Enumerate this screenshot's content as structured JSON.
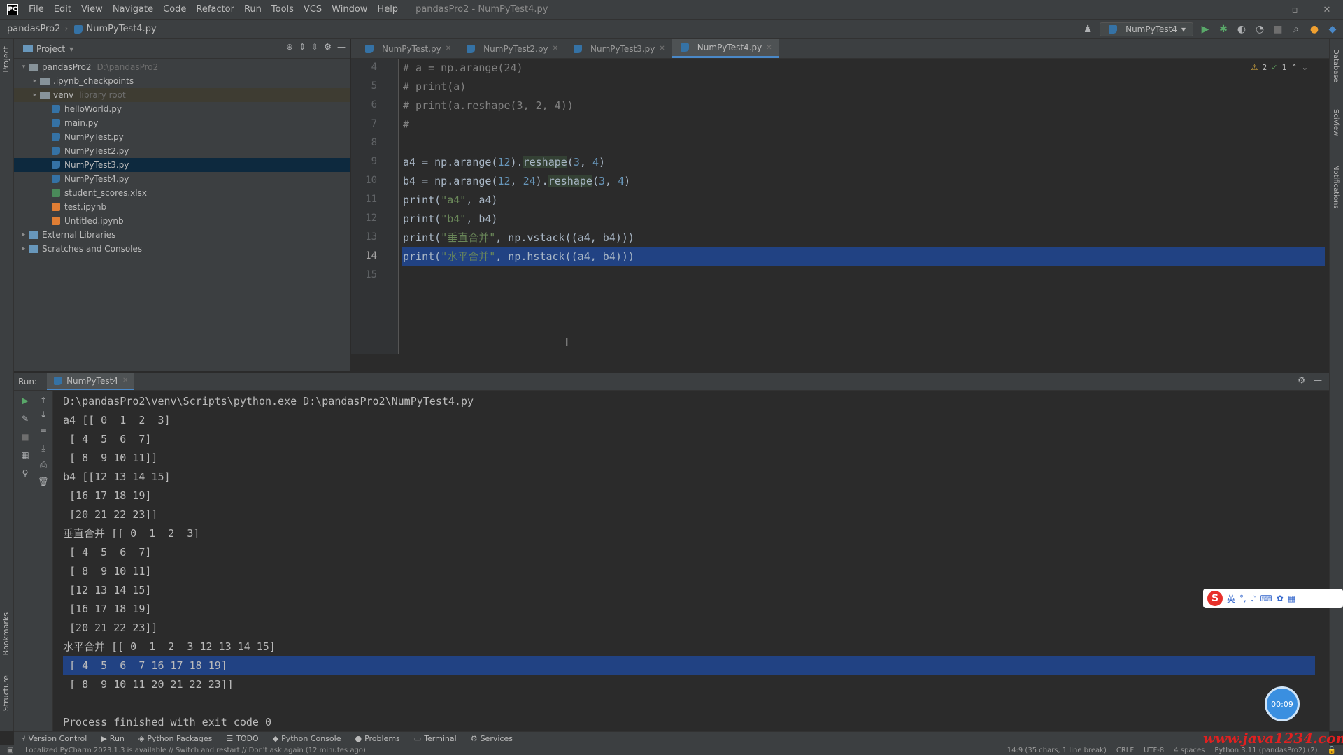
{
  "window": {
    "logo": "PC",
    "menu": [
      "File",
      "Edit",
      "View",
      "Navigate",
      "Code",
      "Refactor",
      "Run",
      "Tools",
      "VCS",
      "Window",
      "Help"
    ],
    "title": "pandasPro2 - NumPyTest4.py",
    "minimize": "–",
    "maximize": "▫",
    "close": "✕"
  },
  "navbar": {
    "project": "pandasPro2",
    "file": "NumPyTest4.py",
    "run_config": "NumPyTest4"
  },
  "project_panel": {
    "title": "Project",
    "items": [
      {
        "label": "pandasPro2",
        "hint": "D:\\pandasPro2",
        "icon": "folder-icon",
        "depth": 0,
        "arrow": "▾"
      },
      {
        "label": ".ipynb_checkpoints",
        "hint": "",
        "icon": "folder-icon",
        "depth": 1,
        "arrow": "▸"
      },
      {
        "label": "venv",
        "hint": "library root",
        "icon": "folder-icon",
        "depth": 1,
        "arrow": "▸"
      },
      {
        "label": "helloWorld.py",
        "hint": "",
        "icon": "python-file-icon",
        "depth": 2,
        "arrow": ""
      },
      {
        "label": "main.py",
        "hint": "",
        "icon": "python-file-icon",
        "depth": 2,
        "arrow": ""
      },
      {
        "label": "NumPyTest.py",
        "hint": "",
        "icon": "python-file-icon",
        "depth": 2,
        "arrow": ""
      },
      {
        "label": "NumPyTest2.py",
        "hint": "",
        "icon": "python-file-icon",
        "depth": 2,
        "arrow": ""
      },
      {
        "label": "NumPyTest3.py",
        "hint": "",
        "icon": "python-file-icon",
        "depth": 2,
        "arrow": ""
      },
      {
        "label": "NumPyTest4.py",
        "hint": "",
        "icon": "python-file-icon",
        "depth": 2,
        "arrow": ""
      },
      {
        "label": "student_scores.xlsx",
        "hint": "",
        "icon": "excel-file-icon",
        "depth": 2,
        "arrow": ""
      },
      {
        "label": "test.ipynb",
        "hint": "",
        "icon": "notebook-file-icon",
        "depth": 2,
        "arrow": ""
      },
      {
        "label": "Untitled.ipynb",
        "hint": "",
        "icon": "notebook-file-icon",
        "depth": 2,
        "arrow": ""
      },
      {
        "label": "External Libraries",
        "hint": "",
        "icon": "library-icon",
        "depth": 0,
        "arrow": "▸"
      },
      {
        "label": "Scratches and Consoles",
        "hint": "",
        "icon": "scratches-icon",
        "depth": 0,
        "arrow": "▸"
      }
    ],
    "selected_index": 7
  },
  "tabs": [
    "NumPyTest.py",
    "NumPyTest2.py",
    "NumPyTest3.py",
    "NumPyTest4.py"
  ],
  "active_tab": 3,
  "editor": {
    "inspection": {
      "warnings": "2",
      "ok": "1"
    },
    "line_numbers": [
      "4",
      "5",
      "6",
      "7",
      "8",
      "9",
      "10",
      "11",
      "12",
      "13",
      "14",
      "15"
    ],
    "current_line": "14",
    "lines": [
      "# a = np.arange(24)",
      "# print(a)",
      "# print(a.reshape(3, 2, 4))",
      "#",
      "",
      "a4 = np.arange(12).reshape(3, 4)",
      "b4 = np.arange(12, 24).reshape(3, 4)",
      "print(\"a4\", a4)",
      "print(\"b4\", b4)",
      "print(\"垂直合并\", np.vstack((a4, b4)))",
      "print(\"水平合并\", np.hstack((a4, b4)))",
      ""
    ]
  },
  "run": {
    "label": "Run:",
    "tab": "NumPyTest4",
    "output": [
      "D:\\pandasPro2\\venv\\Scripts\\python.exe D:\\pandasPro2\\NumPyTest4.py",
      "a4 [[ 0  1  2  3]",
      " [ 4  5  6  7]",
      " [ 8  9 10 11]]",
      "b4 [[12 13 14 15]",
      " [16 17 18 19]",
      " [20 21 22 23]]",
      "垂直合并 [[ 0  1  2  3]",
      " [ 4  5  6  7]",
      " [ 8  9 10 11]",
      " [12 13 14 15]",
      " [16 17 18 19]",
      " [20 21 22 23]]",
      "水平合并 [[ 0  1  2  3 12 13 14 15]",
      " [ 4  5  6  7 16 17 18 19]",
      " [ 8  9 10 11 20 21 22 23]]",
      "",
      "Process finished with exit code 0"
    ],
    "highlighted_line": 14
  },
  "bottom_tabs": [
    "Version Control",
    "Run",
    "Python Packages",
    "TODO",
    "Python Console",
    "Problems",
    "Terminal",
    "Services"
  ],
  "status": {
    "message": "Localized PyCharm 2023.1.3 is available // Switch and restart // Don't ask again (12 minutes ago)",
    "position": "14:9 (35 chars, 1 line break)",
    "line_sep": "CRLF",
    "encoding": "UTF-8",
    "indent": "4 spaces",
    "interpreter": "Python 3.11 (pandasPro2) (2)"
  },
  "ime": {
    "logo": "S",
    "mode": "英"
  },
  "float_widget": "00:09",
  "watermark": "www.java1234.com",
  "colors": {
    "selection": "#214283",
    "accent": "#4a88c7",
    "background": "#2b2b2b"
  }
}
